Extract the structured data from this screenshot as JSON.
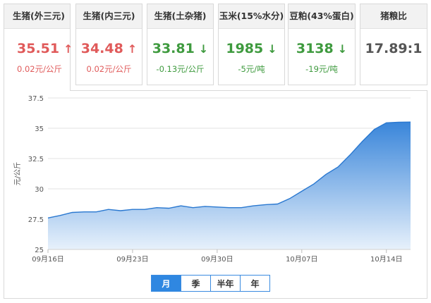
{
  "cards": [
    {
      "title": "生猪(外三元)",
      "value": "35.51",
      "arrow": "↑",
      "trend": "up",
      "change": "0.02元/公斤"
    },
    {
      "title": "生猪(内三元)",
      "value": "34.48",
      "arrow": "↑",
      "trend": "up",
      "change": "0.02元/公斤"
    },
    {
      "title": "生猪(土杂猪)",
      "value": "33.81",
      "arrow": "↓",
      "trend": "down",
      "change": "-0.13元/公斤"
    },
    {
      "title": "玉米(15%水分)",
      "value": "1985",
      "arrow": "↓",
      "trend": "down",
      "change": "-5元/吨"
    },
    {
      "title": "豆粕(43%蛋白)",
      "value": "3138",
      "arrow": "↓",
      "trend": "down",
      "change": "-19元/吨"
    },
    {
      "title": "猪粮比",
      "value": "17.89:1",
      "arrow": "",
      "trend": "neutral",
      "change": ""
    }
  ],
  "colors": {
    "up": "#e05a5a",
    "down": "#3e9a3e",
    "accent": "#2f87e1",
    "area_top": "#2f7fd8",
    "area_bottom": "#e6f0fb"
  },
  "tabs": [
    {
      "label": "月",
      "selected": true
    },
    {
      "label": "季",
      "selected": false
    },
    {
      "label": "半年",
      "selected": false
    },
    {
      "label": "年",
      "selected": false
    }
  ],
  "chart_data": {
    "type": "area",
    "ylabel": "元/公斤",
    "ylim": [
      25,
      37.5
    ],
    "yticks": [
      25,
      27.5,
      30,
      32.5,
      35,
      37.5
    ],
    "xticks": [
      {
        "label": "09月16日",
        "index": 0
      },
      {
        "label": "09月23日",
        "index": 7
      },
      {
        "label": "09月30日",
        "index": 14
      },
      {
        "label": "10月07日",
        "index": 21
      },
      {
        "label": "10月14日",
        "index": 28
      }
    ],
    "grid": true,
    "series": [
      {
        "values": [
          27.6,
          27.8,
          28.05,
          28.1,
          28.1,
          28.3,
          28.2,
          28.3,
          28.3,
          28.45,
          28.4,
          28.6,
          28.45,
          28.55,
          28.5,
          28.45,
          28.45,
          28.6,
          28.7,
          28.75,
          29.2,
          29.8,
          30.4,
          31.2,
          31.8,
          32.8,
          33.9,
          34.9,
          35.45,
          35.5,
          35.51
        ]
      }
    ]
  }
}
